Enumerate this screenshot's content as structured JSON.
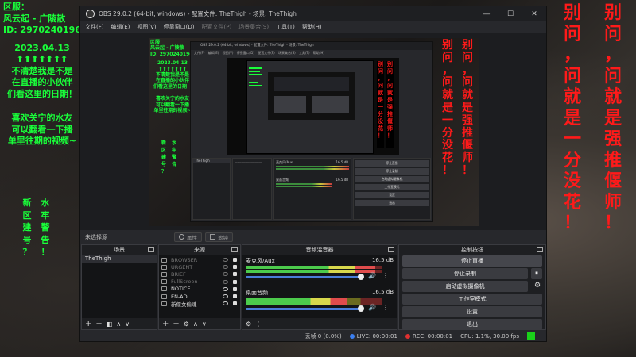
{
  "overlay": {
    "left_lines": [
      "区服：",
      "风云起 - 广陵散",
      "ID: 2970240196"
    ],
    "date": "2023.04.13",
    "arrows": "⬆⬆⬆⬆⬆⬆⬆",
    "notice_lines": [
      "不清楚我是不是",
      "在直播的小伙伴",
      "们看这里的日期！"
    ],
    "fans_lines": [
      "喜欢关宁的水友",
      "可以翻看一下播",
      "单里往期的视频~"
    ],
    "vertical_col1": [
      "新",
      "区",
      "建",
      "号",
      "？"
    ],
    "vertical_col2": [
      "水",
      "牢",
      "警",
      "告",
      "！"
    ],
    "red_col1": [
      "别",
      "问",
      "，",
      "问",
      "就",
      "是",
      "一",
      "分",
      "没",
      "花",
      "！"
    ],
    "red_col2": [
      "别",
      "问",
      "，",
      "问",
      "就",
      "是",
      "强",
      "推",
      "偃",
      "师",
      "！"
    ],
    "colors": {
      "green": "#19ff3a",
      "red": "#ff1a1a"
    }
  },
  "window": {
    "title": "OBS 29.0.2 (64-bit, windows) - 配置文件: TheThigh - 场景: TheThigh",
    "minimize": "—",
    "maximize": "☐",
    "close": "✕"
  },
  "menu": {
    "items": [
      "文件(F)",
      "编辑(E)",
      "视图(V)",
      "停靠窗口(D)",
      "配置文件(P)",
      "场景集合(S)",
      "工具(T)",
      "帮助(H)"
    ]
  },
  "preview_bar": {
    "no_source": "未选择源",
    "properties": "属性",
    "filters": "滤镜"
  },
  "nested": {
    "title": "OBS 29.0.2 (64-bit, windows) - 配置文件: TheThigh - 场景: TheThigh",
    "menu": "文件(F) 编辑(E) 视图(V) 停靠窗口(D) 配置文件(P) 场景集合(S) 工具(T) 帮助(H)",
    "ctrl": [
      "停止直播",
      "停止录制",
      "启动虚拟摄像机",
      "工作室模式",
      "设置",
      "退出"
    ],
    "scene": "TheThigh",
    "mic": "麦克风/Aux",
    "desktop": "桌面音频",
    "db": "16.5 dB"
  },
  "docks": {
    "scenes": {
      "title": "场景",
      "items": [
        "TheThigh"
      ]
    },
    "sources": {
      "title": "来源",
      "items": [
        {
          "name": "BROWSER",
          "visible": false
        },
        {
          "name": "URGENT",
          "visible": false
        },
        {
          "name": "BRIEF",
          "visible": false
        },
        {
          "name": "FullScreen",
          "visible": false
        },
        {
          "name": "NOTICE",
          "visible": true
        },
        {
          "name": "EN-AD",
          "visible": true
        },
        {
          "name": "新偃女偷魂",
          "visible": true
        }
      ]
    },
    "mixer": {
      "title": "音频混音器",
      "tracks": [
        {
          "name": "麦克风/Aux",
          "db": "16.5 dB",
          "level": 0.95,
          "volume": 0.97
        },
        {
          "name": "桌面音频",
          "db": "16.5 dB",
          "level": 0.74,
          "volume": 0.97
        }
      ]
    },
    "controls": {
      "title": "控制按钮",
      "stop_stream": "停止直播",
      "stop_record": "停止录制",
      "pause": "⏸",
      "virtual_cam": "启动虚拟摄像机",
      "studio_mode": "工作室模式",
      "settings": "设置",
      "exit": "退出"
    }
  },
  "status": {
    "dropped": "丢帧 0 (0.0%)",
    "live": "LIVE: 00:00:01",
    "rec": "REC: 00:00:01",
    "cpu": "CPU: 1.1%, 30.00 fps"
  }
}
